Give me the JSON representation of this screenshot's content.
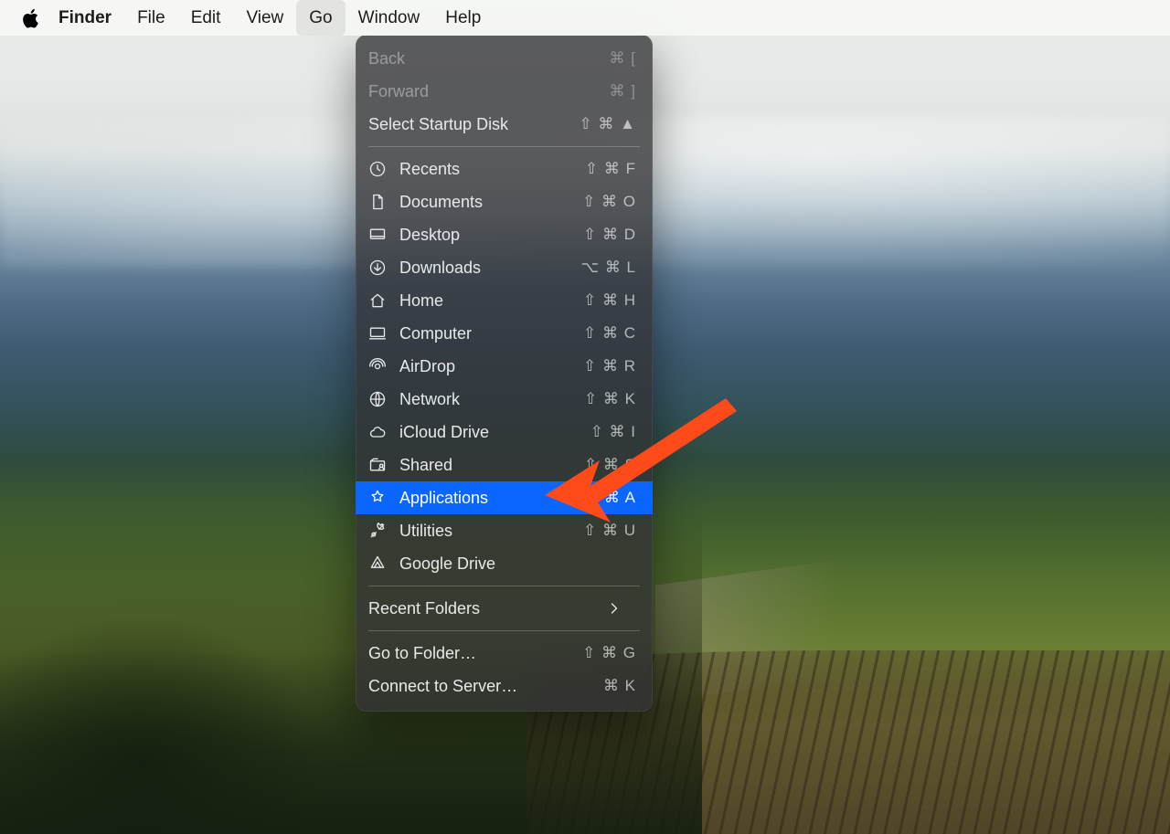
{
  "menubar": {
    "app_name": "Finder",
    "items": [
      "File",
      "Edit",
      "View",
      "Go",
      "Window",
      "Help"
    ],
    "active_index": 3
  },
  "dropdown": {
    "sections": [
      [
        {
          "icon": null,
          "label": "Back",
          "shortcut": "⌘ [",
          "enabled": false
        },
        {
          "icon": null,
          "label": "Forward",
          "shortcut": "⌘ ]",
          "enabled": false
        },
        {
          "icon": null,
          "label": "Select Startup Disk",
          "shortcut": "⇧ ⌘ ▲",
          "enabled": true
        }
      ],
      [
        {
          "icon": "clock-icon",
          "label": "Recents",
          "shortcut": "⇧ ⌘ F",
          "enabled": true
        },
        {
          "icon": "document-icon",
          "label": "Documents",
          "shortcut": "⇧ ⌘ O",
          "enabled": true
        },
        {
          "icon": "desktop-icon",
          "label": "Desktop",
          "shortcut": "⇧ ⌘ D",
          "enabled": true
        },
        {
          "icon": "download-icon",
          "label": "Downloads",
          "shortcut": "⌥ ⌘ L",
          "enabled": true
        },
        {
          "icon": "home-icon",
          "label": "Home",
          "shortcut": "⇧ ⌘ H",
          "enabled": true
        },
        {
          "icon": "computer-icon",
          "label": "Computer",
          "shortcut": "⇧ ⌘ C",
          "enabled": true
        },
        {
          "icon": "airdrop-icon",
          "label": "AirDrop",
          "shortcut": "⇧ ⌘ R",
          "enabled": true
        },
        {
          "icon": "network-icon",
          "label": "Network",
          "shortcut": "⇧ ⌘ K",
          "enabled": true
        },
        {
          "icon": "cloud-icon",
          "label": "iCloud Drive",
          "shortcut": "⇧ ⌘ I",
          "enabled": true
        },
        {
          "icon": "shared-icon",
          "label": "Shared",
          "shortcut": "⇧ ⌘ S",
          "enabled": true
        },
        {
          "icon": "applications-icon",
          "label": "Applications",
          "shortcut": "⇧ ⌘ A",
          "enabled": true,
          "highlighted": true
        },
        {
          "icon": "utilities-icon",
          "label": "Utilities",
          "shortcut": "⇧ ⌘ U",
          "enabled": true
        },
        {
          "icon": "googledrive-icon",
          "label": "Google Drive",
          "shortcut": "",
          "enabled": true
        }
      ],
      [
        {
          "icon": null,
          "label": "Recent Folders",
          "shortcut": "",
          "enabled": true,
          "submenu": true
        }
      ],
      [
        {
          "icon": null,
          "label": "Go to Folder…",
          "shortcut": "⇧ ⌘ G",
          "enabled": true
        },
        {
          "icon": null,
          "label": "Connect to Server…",
          "shortcut": "⌘ K",
          "enabled": true
        }
      ]
    ]
  },
  "annotation": {
    "type": "arrow",
    "color": "#ff4a1a",
    "points_to": "Applications"
  }
}
